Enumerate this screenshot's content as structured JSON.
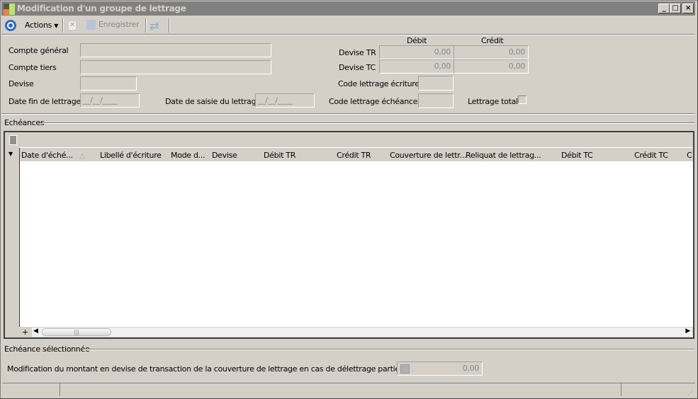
{
  "window": {
    "title": "Modification d'un groupe de lettrage",
    "min": "_",
    "max": "□",
    "close": "×"
  },
  "toolbar": {
    "actions": "Actions",
    "save": "Enregistrer"
  },
  "form": {
    "compte_general": "Compte général",
    "compte_tiers": "Compte tiers",
    "devise": "Devise",
    "date_fin": "Date fin de lettrage",
    "date_fin_value": "__/__/____",
    "date_saisie": "Date de saisie du lettrage",
    "date_saisie_value": "__/__/____",
    "debit_header": "Débit",
    "credit_header": "Crédit",
    "devise_tr": "Devise TR",
    "devise_tr_debit": "0,00",
    "devise_tr_credit": "0,00",
    "devise_tc": "Devise TC",
    "devise_tc_debit": "0,00",
    "devise_tc_credit": "0,00",
    "code_ecritures": "Code lettrage écritures",
    "code_echeances": "Code lettrage échéances",
    "lettrage_total": "Lettrage total",
    "lettrage_total_checked": false
  },
  "echeances": {
    "title": "Echéances",
    "columns": [
      "Date d'éché...",
      "Libellé d'écriture",
      "Mode d...",
      "Devise",
      "Débit TR",
      "Crédit TR",
      "Couverture de lettr...",
      "Reliquat de lettrag...",
      "Débit TC",
      "Crédit TC",
      "C"
    ],
    "add": "+"
  },
  "selected": {
    "title": "Echéance sélectionnée",
    "label": "Modification du montant en devise de transaction de la couverture de lettrage en cas de délettrage partiel",
    "value": "0,00"
  }
}
